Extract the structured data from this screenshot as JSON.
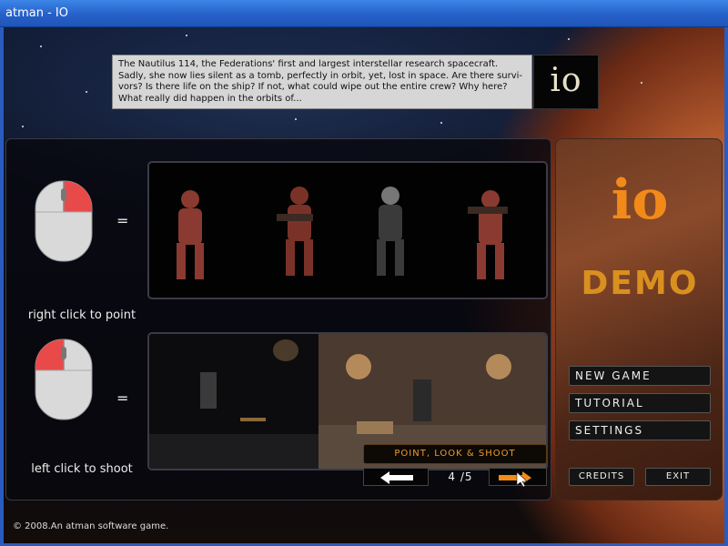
{
  "window": {
    "title": "atman - IO"
  },
  "intro": {
    "lines": [
      "The Nautilus 114, the Federations' first and largest interstellar research spacecraft.",
      "Sadly, she now lies silent as a tomb, perfectly in orbit, yet, lost in space. Are there survi-",
      "vors? Is there life on the ship? If not, what could wipe out the entire crew? Why here?",
      "What really did happen in the orbits of..."
    ],
    "logo": "IO"
  },
  "tutorial": {
    "right_click_caption": "right click to point",
    "left_click_caption": "left click to shoot",
    "equals": "=",
    "step_title": "POINT, LOOK & SHOOT",
    "page": "4 /5"
  },
  "side": {
    "logo": "IO",
    "demo_label": "DEMO",
    "menu": [
      "NEW GAME",
      "TUTORIAL",
      "SETTINGS"
    ],
    "credits": "CREDITS",
    "exit": "EXIT"
  },
  "footer": {
    "copyright": "© 2008.An atman software game."
  },
  "colors": {
    "accent": "#f28a1a",
    "mouse_highlight": "#e84a4a",
    "titlebar": "#2660c9"
  }
}
